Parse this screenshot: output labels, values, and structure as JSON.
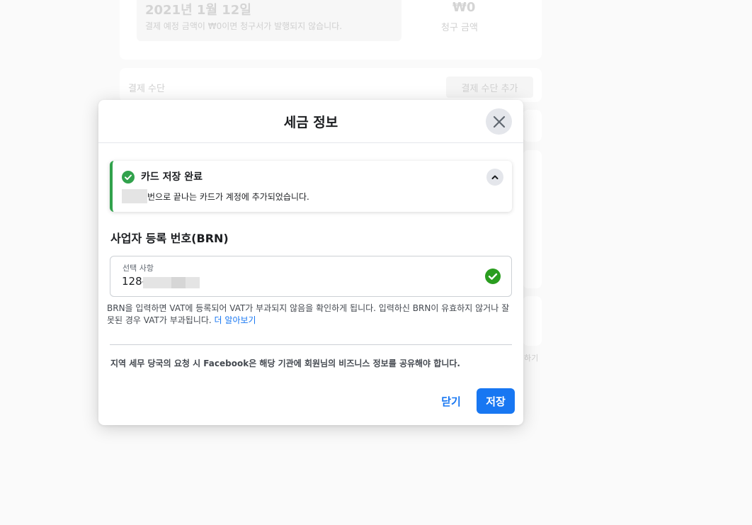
{
  "background": {
    "billing_date": "2021년 1월 12일",
    "billing_note": "결제 예정 금액이 ₩0이면 청구서가 발행되지 않습니다.",
    "amount": "₩0",
    "amount_label": "청구 금액",
    "payment_methods_label": "결제 수단",
    "add_payment_button": "결제 수단 추가",
    "side_text": "하기"
  },
  "modal": {
    "title": "세금 정보",
    "close_icon": "close-icon",
    "notice": {
      "title": "카드 저장 완료",
      "message": "번으로 끝나는 카드가 계정에 추가되었습니다.",
      "status_color": "#31a24c"
    },
    "brn_section_title": "사업자 등록 번호(BRN)",
    "brn_field": {
      "label": "선택 사항",
      "value": "128-"
    },
    "help_text": "BRN을 입력하면 VAT에 등록되어 VAT가 부과되지 않음을 확인하게 됩니다. 입력하신 BRN이 유효하지 않거나 잘못된 경우 VAT가 부과됩니다.",
    "learn_more": "더 알아보기",
    "share_notice": "지역 세무 당국의 요청 시 Facebook은 해당 기관에 회원님의 비즈니스 정보를 공유해야 합니다.",
    "close_button": "닫기",
    "save_button": "저장"
  },
  "colors": {
    "primary": "#1877f2",
    "success": "#31a24c"
  }
}
